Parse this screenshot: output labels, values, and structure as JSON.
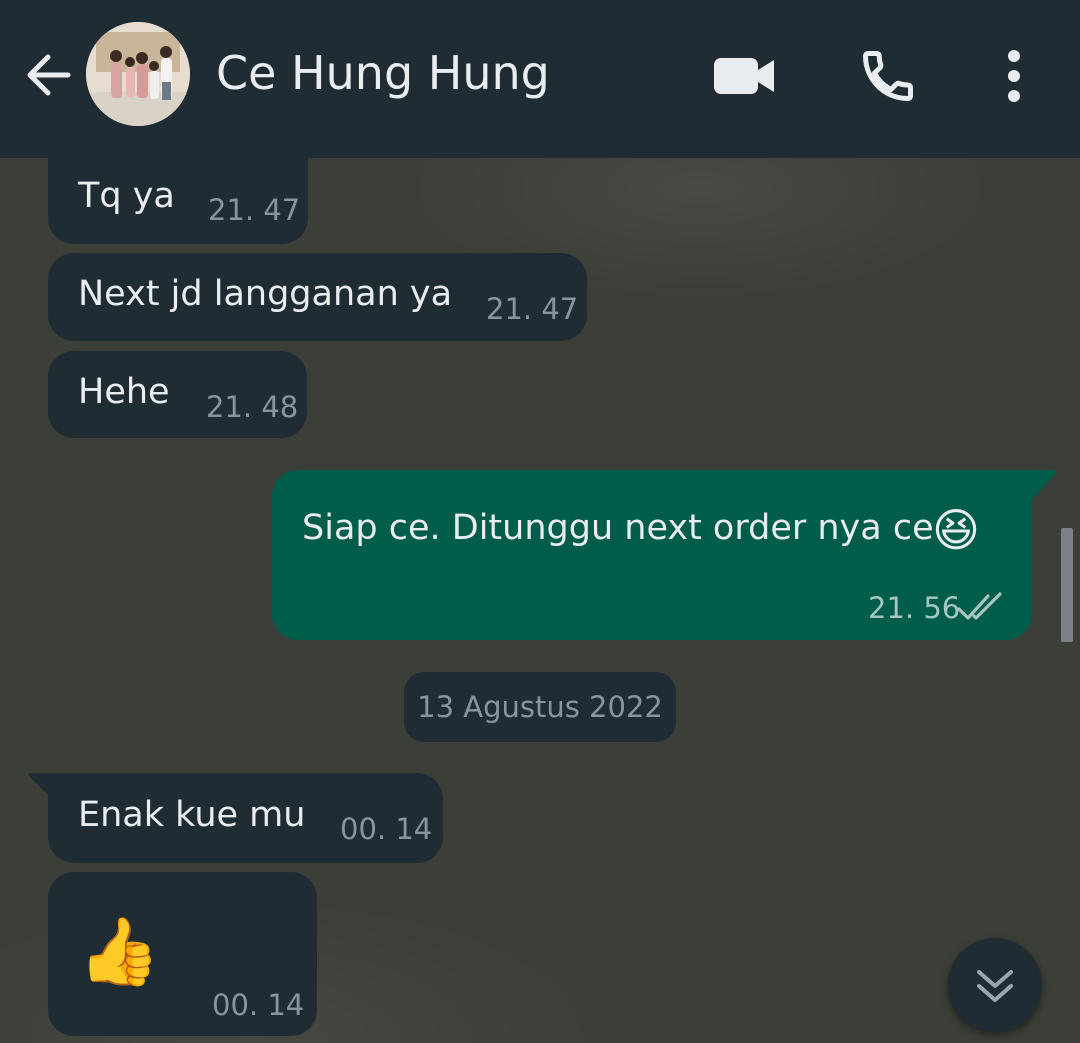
{
  "header": {
    "contact_name": "Ce Hung Hung",
    "icons": [
      "arrow-left-icon",
      "contact-avatar",
      "video-camera-icon",
      "phone-icon",
      "more-vertical-icon"
    ]
  },
  "messages": [
    {
      "direction": "in",
      "text": "Tq ya",
      "time": "21. 47"
    },
    {
      "direction": "in",
      "text": "Next  jd langganan ya",
      "time": "21. 47"
    },
    {
      "direction": "in",
      "text": "Hehe",
      "time": "21. 48"
    },
    {
      "direction": "out",
      "text": "Siap ce.  Ditunggu next order nya ce",
      "emoji": "😆",
      "time": "21. 56",
      "status_icon": "double-check-icon"
    },
    {
      "direction": "in",
      "text": "Enak kue mu",
      "time": "00. 14"
    },
    {
      "direction": "in",
      "emoji": "👍",
      "time": "00. 14"
    }
  ],
  "date_separator": "13 Agustus 2022",
  "colors": {
    "header_bg": "#202c33",
    "incoming_bubble": "#202c33",
    "outgoing_bubble": "#005c4b",
    "chat_bg": "#3b3f37",
    "text_primary": "#e9edef",
    "text_secondary": "#8696a0"
  }
}
